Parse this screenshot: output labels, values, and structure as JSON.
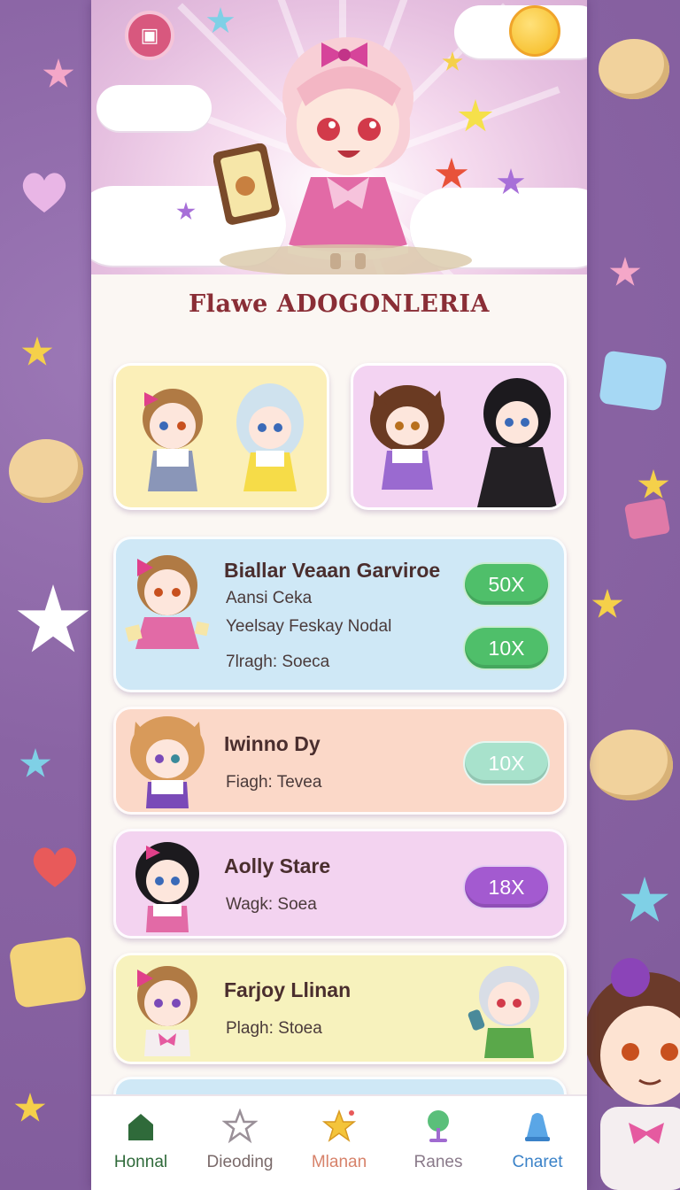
{
  "app": {
    "title": "Flawe ADOGONLERIA"
  },
  "theme": {
    "background": "#8e6aa8",
    "title_color": "#8a2e36",
    "accent_green": "#4fbf6a",
    "accent_mint": "#a8e2cc",
    "accent_purple": "#a35ad0"
  },
  "featured": [
    {
      "name": "featured-duo-yellow",
      "bg": "#fbefb8"
    },
    {
      "name": "featured-duo-pink",
      "bg": "#f3d3f2"
    }
  ],
  "list": [
    {
      "title": "Biallar Veaan Garviroe",
      "lines": [
        "Aansi Ceka",
        "Yeelsay Feskay Nodal",
        "7lragh: Soeca"
      ],
      "buttons": [
        "50X",
        "10X"
      ],
      "bg": "#cfe8f6"
    },
    {
      "title": "Iwinno Dy",
      "lines": [
        "Fiagh: Tevea"
      ],
      "buttons": [
        "10X"
      ],
      "bg": "#fbd8c8"
    },
    {
      "title": "Aolly Stare",
      "lines": [
        "Wagk: Soea"
      ],
      "buttons": [
        "18X"
      ],
      "bg": "#f3d3f0"
    },
    {
      "title": "Farjoy Llinan",
      "lines": [
        "Plagh: Stoea"
      ],
      "buttons": [],
      "bg": "#f7f2bd"
    }
  ],
  "nav": [
    {
      "label": "Honnal",
      "icon": "home-icon",
      "color": "#2f6a3a"
    },
    {
      "label": "Dieoding",
      "icon": "star-outline-icon",
      "color": "#7a6a6a"
    },
    {
      "label": "Mlanan",
      "icon": "star-icon",
      "color": "#d7826a"
    },
    {
      "label": "Ranes",
      "icon": "tree-icon",
      "color": "#8a7a8a"
    },
    {
      "label": "Cnaret",
      "icon": "bell-icon",
      "color": "#3a82c8"
    }
  ]
}
